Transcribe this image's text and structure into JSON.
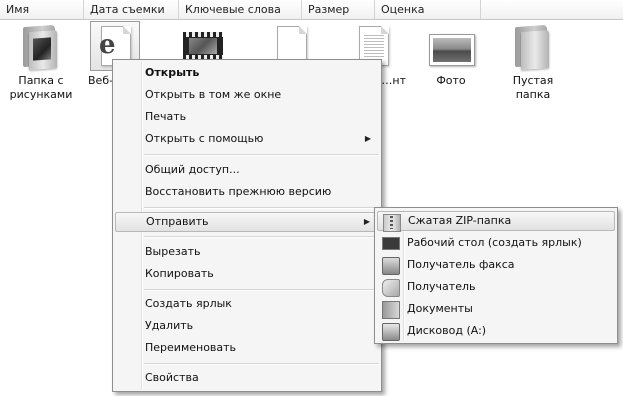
{
  "columns": [
    "Имя",
    "Дата съемки",
    "Ключевые слова",
    "Размер",
    "Оценка"
  ],
  "files": [
    {
      "label": "Папка с рисунками"
    },
    {
      "label": "Веб-"
    },
    {
      "label": ""
    },
    {
      "label": ""
    },
    {
      "label": "…ый …нт"
    },
    {
      "label": "Фото"
    },
    {
      "label": "Пустая папка"
    }
  ],
  "context_menu": {
    "items": [
      {
        "label": "Открыть"
      },
      {
        "label": "Открыть в том же окне"
      },
      {
        "label": "Печать"
      },
      {
        "label": "Открыть с помощью"
      },
      {
        "label": "Общий доступ..."
      },
      {
        "label": "Восстановить прежнюю версию"
      },
      {
        "label": "Отправить"
      },
      {
        "label": "Вырезать"
      },
      {
        "label": "Копировать"
      },
      {
        "label": "Создать ярлык"
      },
      {
        "label": "Удалить"
      },
      {
        "label": "Переименовать"
      },
      {
        "label": "Свойства"
      }
    ]
  },
  "send_to_menu": {
    "items": [
      {
        "label": "Сжатая ZIP-папка",
        "icon": "zip-folder-icon"
      },
      {
        "label": "Рабочий стол (создать ярлык)",
        "icon": "desktop-icon"
      },
      {
        "label": "Получатель факса",
        "icon": "fax-icon"
      },
      {
        "label": "Получатель",
        "icon": "mail-recipient-icon"
      },
      {
        "label": "Документы",
        "icon": "documents-icon"
      },
      {
        "label": "Дисковод (A:)",
        "icon": "floppy-drive-icon"
      }
    ]
  }
}
